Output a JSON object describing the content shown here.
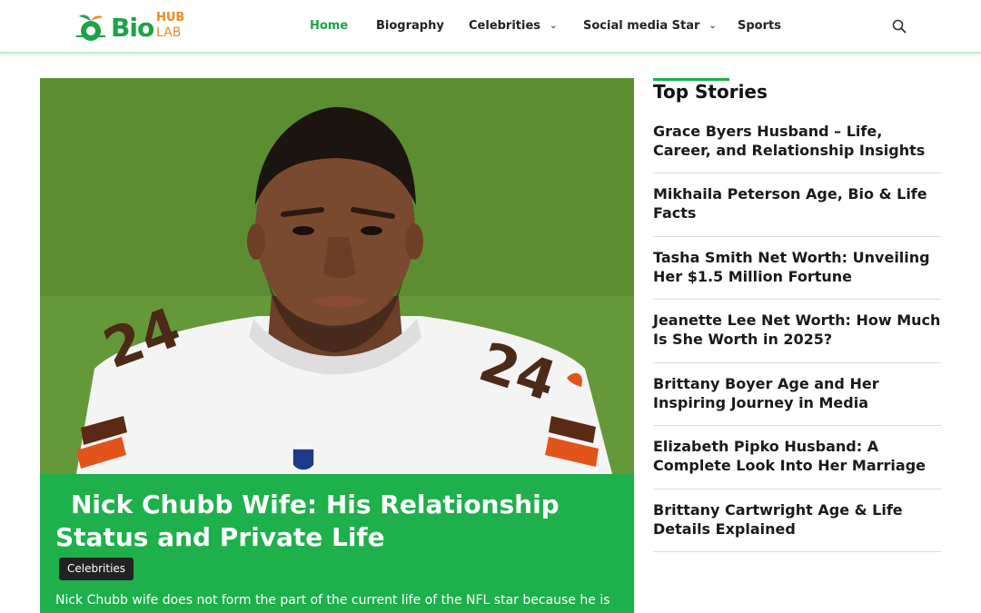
{
  "header": {
    "logo": {
      "main": "Bio",
      "top": "HUB",
      "bottom": "LAB"
    },
    "nav": [
      {
        "label": "Home",
        "active": true
      },
      {
        "label": "Biography"
      },
      {
        "label": "Celebrities",
        "dropdown": true
      },
      {
        "label": "Social media Star",
        "dropdown": true
      },
      {
        "label": "Sports"
      }
    ],
    "icons": {
      "search": "search-icon",
      "chevron": "chevron-down-icon"
    },
    "colors": {
      "accent": "#1ea24a",
      "logo_orange": "#f08a24"
    }
  },
  "feature": {
    "title": "Nick Chubb Wife: His Relationship Status and Private Life",
    "category": "Celebrities",
    "excerpt": "Nick Chubb wife does not form the part of the current life of the NFL star because he is",
    "box_color": "#1db04b"
  },
  "sidebar": {
    "title": "Top Stories",
    "stories": [
      "Grace Byers Husband – Life, Career, and Relationship Insights",
      "Mikhaila Peterson Age, Bio & Life Facts",
      "Tasha Smith Net Worth: Unveiling Her $1.5 Million Fortune",
      "Jeanette Lee Net Worth: How Much Is She Worth in 2025?",
      "Brittany Boyer Age and Her Inspiring Journey in Media",
      "Elizabeth Pipko Husband: A Complete Look Into Her Marriage",
      "Brittany Cartwright Age & Life Details Explained"
    ]
  }
}
